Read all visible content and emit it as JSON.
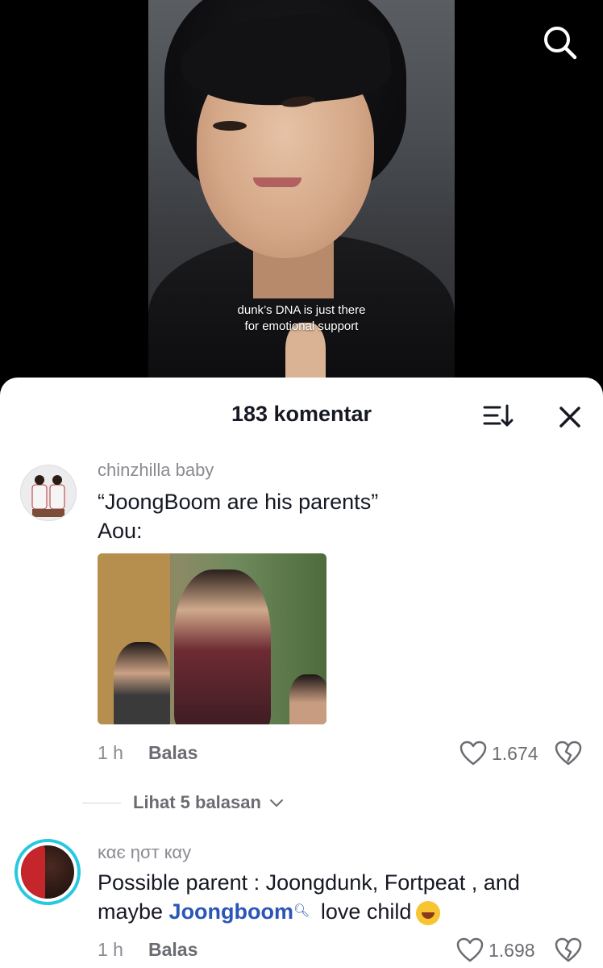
{
  "video": {
    "caption_line1": "dunk’s DNA is just there",
    "caption_line2": "for emotional support"
  },
  "icons": {
    "search": "search-icon",
    "sort": "sort-icon",
    "close": "close-icon",
    "like": "heart-icon",
    "dislike": "broken-heart-icon"
  },
  "comments_sheet": {
    "title": "183 komentar",
    "comments": [
      {
        "username": "chinzhilla baby",
        "text_line1": "“JoongBoom are his parents”",
        "text_line2": "Aou:",
        "time": "1 h",
        "reply_label": "Balas",
        "likes": "1.674",
        "view_replies": "Lihat 5 balasan"
      },
      {
        "username": "καє ησт кαу",
        "text_line1": "Possible parent : Joongdunk, Fortpeat , and",
        "text_line2_prefix": "maybe ",
        "mention": "Joongboom",
        "text_line2_suffix": " love child",
        "time": "1 h",
        "reply_label": "Balas",
        "likes": "1.698"
      }
    ]
  },
  "colors": {
    "accent_mention": "#2b56b7",
    "avatar_ring": "#27c8e0",
    "text_primary": "#161823",
    "text_secondary": "#8a8b91"
  }
}
